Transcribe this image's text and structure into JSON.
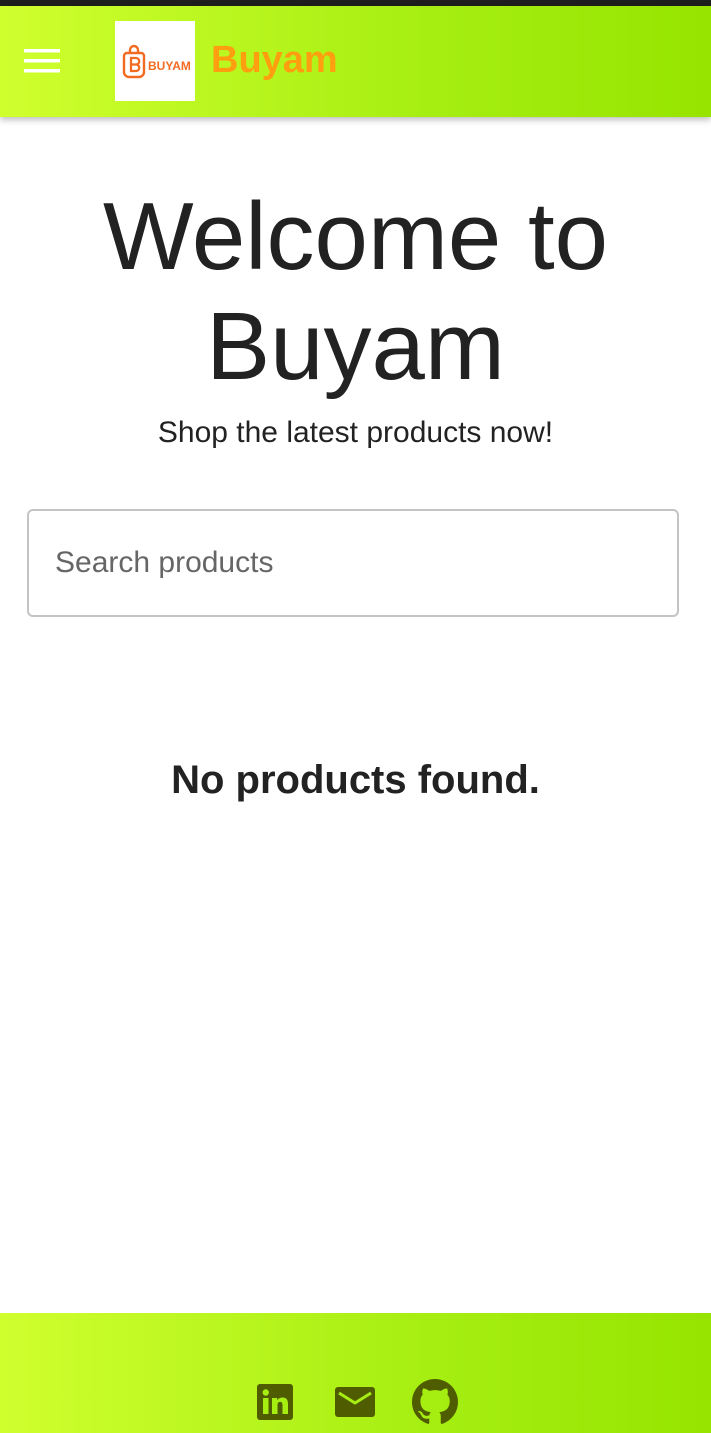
{
  "app": {
    "brand_name": "Buyam",
    "logo_text": "BUYAM",
    "colors": {
      "header_gradient_start": "#d0ff2e",
      "header_gradient_end": "#96e400",
      "brand_text": "#ff9f0f",
      "logo_orange": "#f26b21",
      "icon_dark": "#4f5d00"
    }
  },
  "header": {
    "menu_icon": "hamburger-menu-icon",
    "logo_icon": "shopping-bag-icon"
  },
  "hero": {
    "title": "Welcome to Buyam",
    "subtitle": "Shop the latest products now!"
  },
  "search": {
    "value": "",
    "placeholder": "Search products"
  },
  "products": {
    "empty_message": "No products found."
  },
  "footer": {
    "social": [
      {
        "icon": "linkedin-icon"
      },
      {
        "icon": "email-icon"
      },
      {
        "icon": "github-icon"
      }
    ]
  }
}
